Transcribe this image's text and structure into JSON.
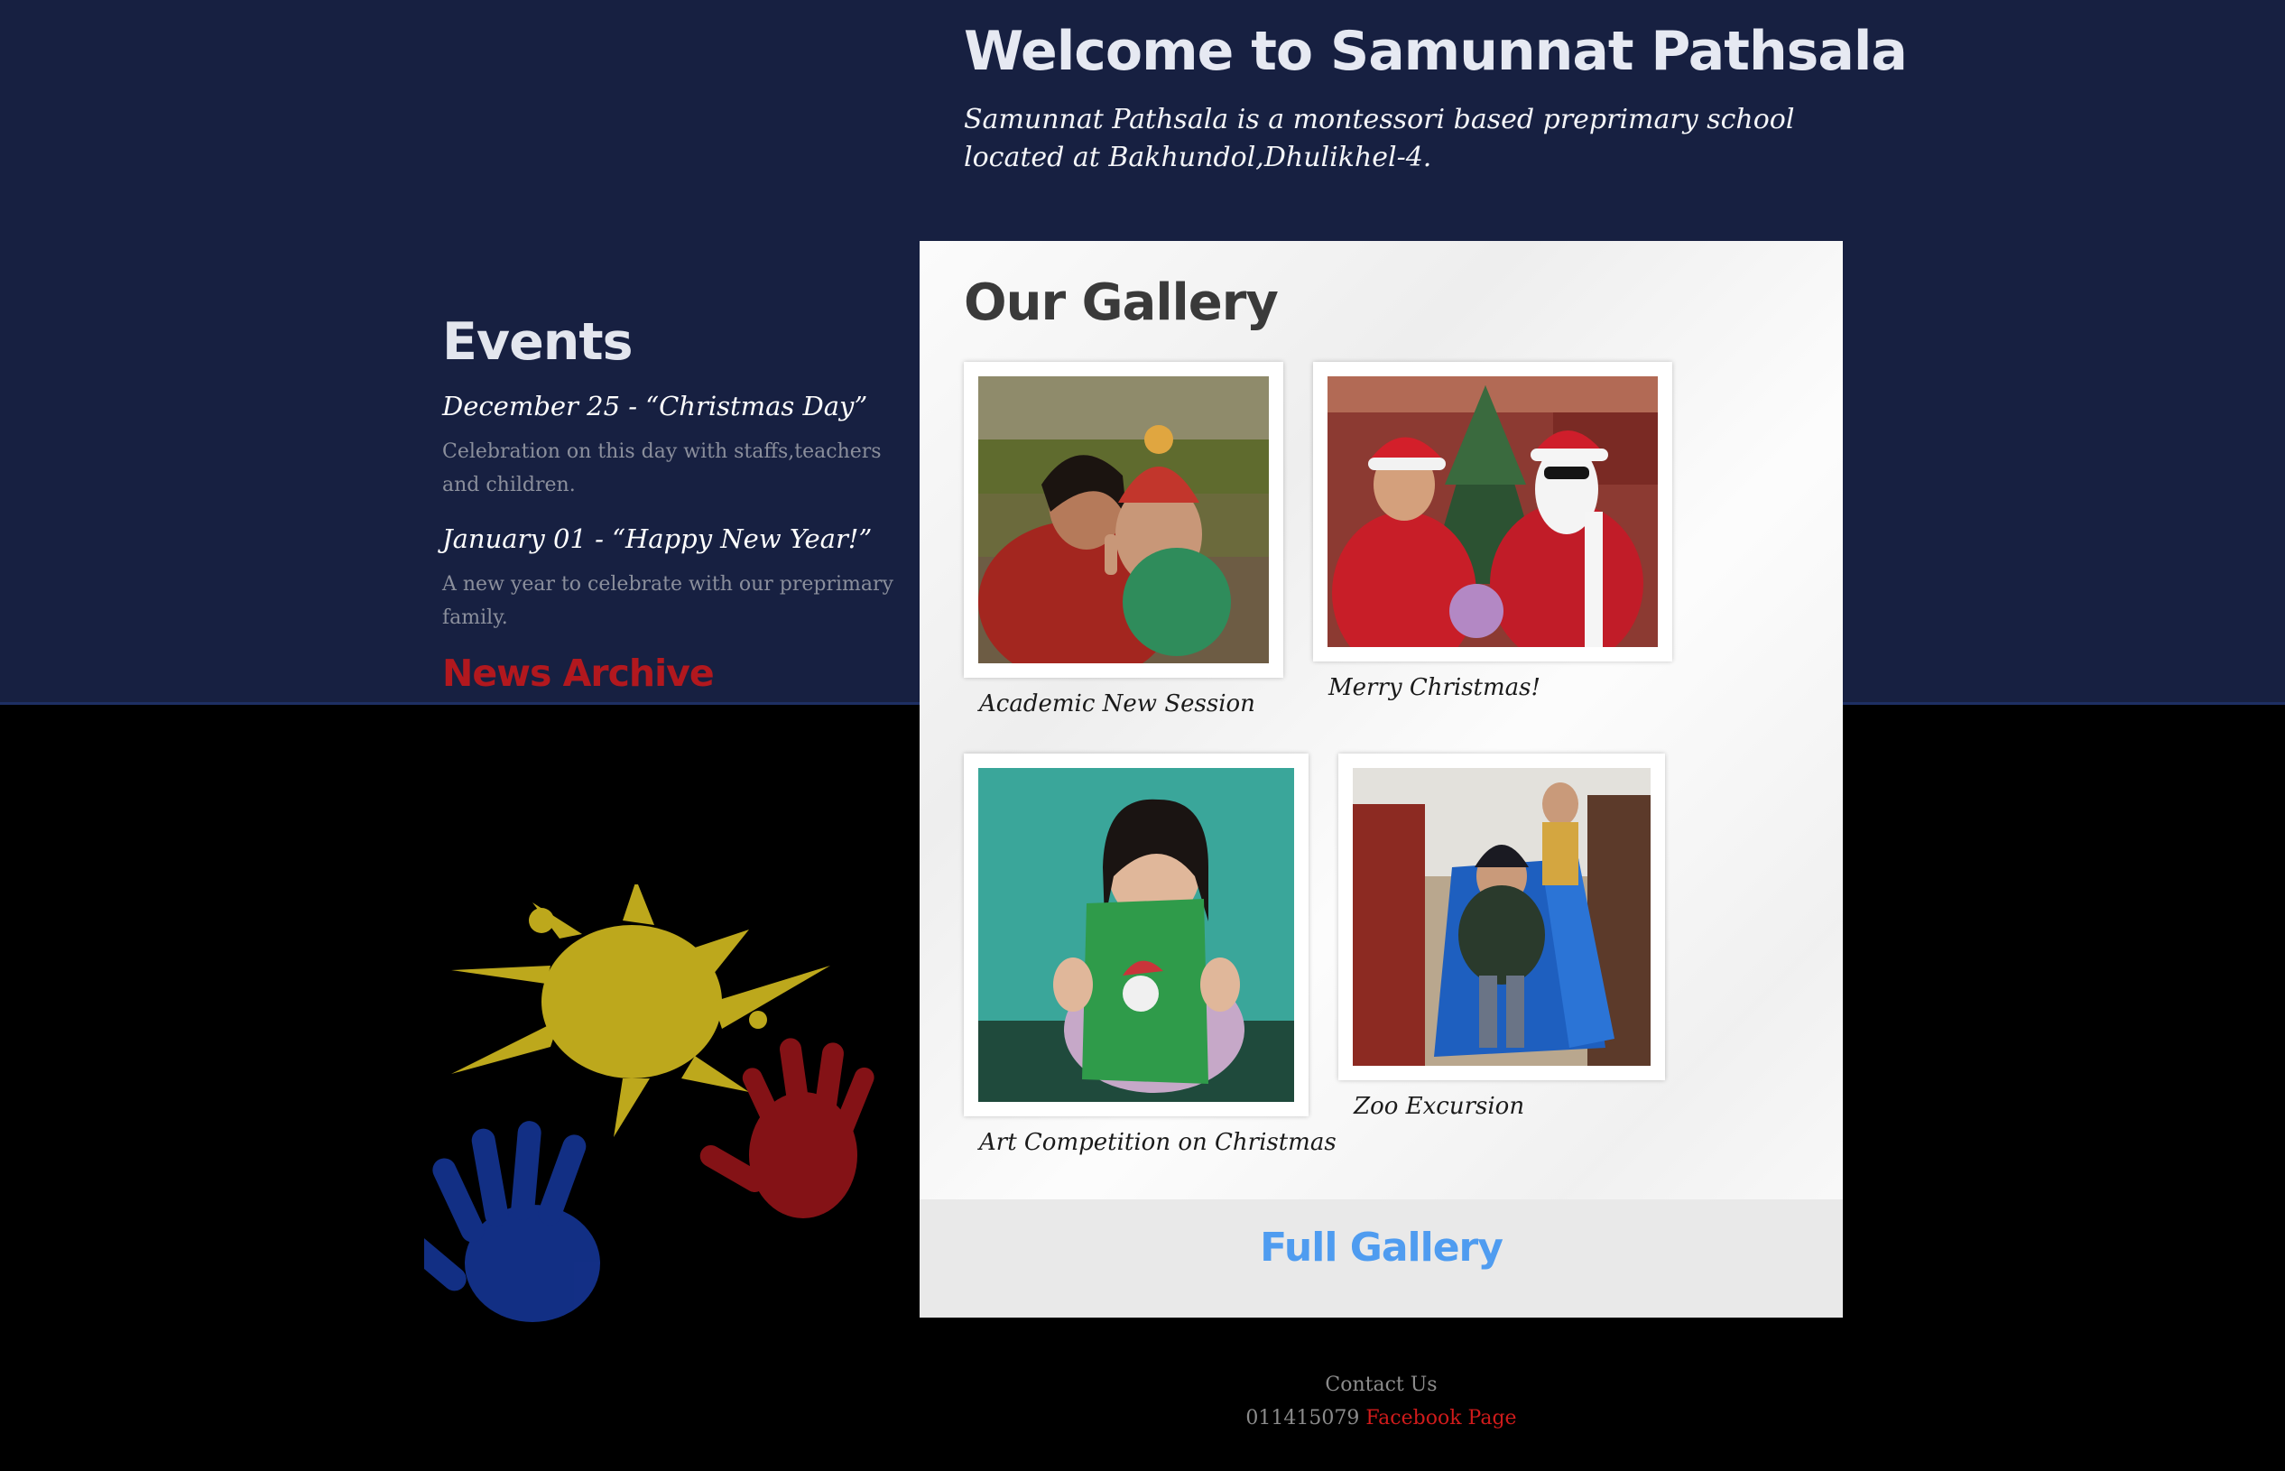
{
  "header": {
    "title": "Welcome to Samunnat Pathsala",
    "description": "Samunnat Pathsala is a montessori based preprimary school located at Bakhundol,Dhulikhel-4."
  },
  "events": {
    "heading": "Events",
    "items": [
      {
        "title": "December 25 - “Christmas Day”",
        "description": "Celebration on this day with staffs,teachers and children."
      },
      {
        "title": "January 01 - “Happy New Year!”",
        "description": "A new year to celebrate with our preprimary family."
      }
    ],
    "news_archive": "News Archive"
  },
  "gallery": {
    "heading": "Our Gallery",
    "items": [
      {
        "caption": "Academic New Session"
      },
      {
        "caption": "Merry Christmas!"
      },
      {
        "caption": "Art Competition on Christmas"
      },
      {
        "caption": "Zoo Excursion"
      }
    ],
    "full_gallery": "Full Gallery"
  },
  "footer": {
    "contact_label": "Contact Us",
    "phone": "011415079",
    "facebook_link": "Facebook Page"
  },
  "colors": {
    "header_bg": "#172041",
    "page_bg": "#000000",
    "accent_red": "#b2181e",
    "link_blue": "#4f9cf0"
  }
}
